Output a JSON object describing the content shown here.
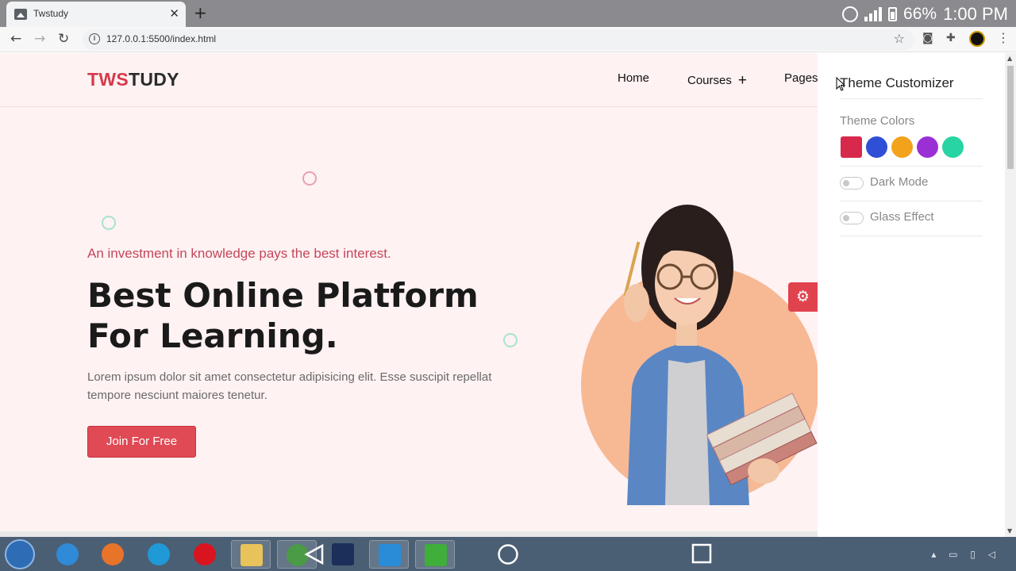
{
  "browser": {
    "tab_title": "Twstudy",
    "tab_close": "✕",
    "new_tab": "+",
    "url": "127.0.0.1:5500/index.html",
    "status": {
      "battery_pct": "66%",
      "time": "1:00 PM"
    }
  },
  "site": {
    "logo_part1": "TWS",
    "logo_part2": "TUDY",
    "nav": [
      {
        "label": "Home"
      },
      {
        "label": "Courses",
        "has_submenu": true
      },
      {
        "label": "Pages"
      }
    ],
    "hero": {
      "tagline": "An investment in knowledge pays the best interest.",
      "title_line1": "Best Online Platform",
      "title_line2": "For Learning.",
      "description": "Lorem ipsum dolor sit amet consectetur adipisicing elit. Esse suscipit repellat tempore nesciunt maiores tenetur.",
      "cta_label": "Join For Free"
    }
  },
  "customizer": {
    "title": "Theme Customizer",
    "colors_label": "Theme Colors",
    "swatches": [
      "#d7294c",
      "#2f4fd6",
      "#f2a31b",
      "#9b2fd6",
      "#28d4a3"
    ],
    "dark_mode_label": "Dark Mode",
    "glass_effect_label": "Glass Effect",
    "dark_mode_on": false,
    "glass_effect_on": false
  },
  "colors": {
    "brand": "#e04a55",
    "page_bg": "#fff2f3",
    "image_circle": "#f7b994"
  }
}
